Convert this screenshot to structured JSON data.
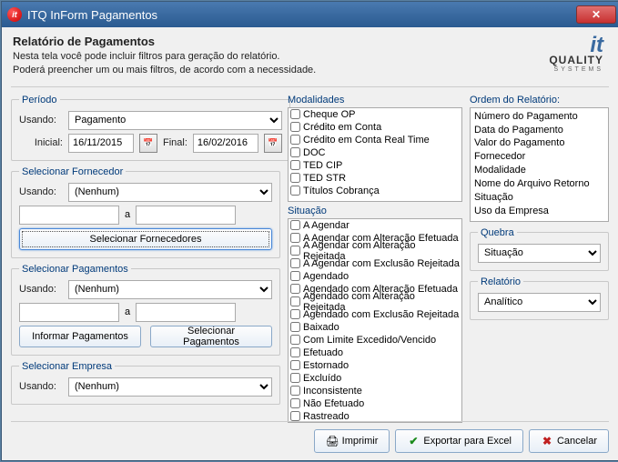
{
  "window": {
    "title": "ITQ InForm Pagamentos"
  },
  "header": {
    "title": "Relatório de Pagamentos",
    "desc_line1": "Nesta tela você pode incluir filtros para geração do relatório.",
    "desc_line2": "Poderá preencher um ou mais filtros, de acordo com a necessidade."
  },
  "periodo": {
    "legend": "Período",
    "usando_label": "Usando:",
    "usando_value": "Pagamento",
    "inicial_label": "Inicial:",
    "inicial_value": "16/11/2015",
    "final_label": "Final:",
    "final_value": "16/02/2016"
  },
  "fornecedor": {
    "legend": "Selecionar Fornecedor",
    "usando_label": "Usando:",
    "usando_value": "(Nenhum)",
    "range_from": "",
    "range_to": "",
    "sep": "a",
    "button": "Selecionar Fornecedores"
  },
  "pagamentos": {
    "legend": "Selecionar Pagamentos",
    "usando_label": "Usando:",
    "usando_value": "(Nenhum)",
    "range_from": "",
    "range_to": "",
    "sep": "a",
    "btn_informar": "Informar Pagamentos",
    "btn_selecionar": "Selecionar Pagamentos"
  },
  "empresa": {
    "legend": "Selecionar Empresa",
    "usando_label": "Usando:",
    "usando_value": "(Nenhum)"
  },
  "modalidades": {
    "label": "Modalidades",
    "items": [
      "Cheque OP",
      "Crédito em Conta",
      "Crédito em Conta Real Time",
      "DOC",
      "TED CIP",
      "TED STR",
      "Títulos Cobrança"
    ]
  },
  "situacao": {
    "label": "Situação",
    "items": [
      "A Agendar",
      "A Agendar com Alteração Efetuada",
      "A Agendar com Alteração Rejeitada",
      "A Agendar com Exclusão Rejeitada",
      "Agendado",
      "Agendado com Alteração Efetuada",
      "Agendado com Alteração Rejeitada",
      "Agendado com Exclusão Rejeitada",
      "Baixado",
      "Com Limite Excedido/Vencido",
      "Efetuado",
      "Estornado",
      "Excluído",
      "Inconsistente",
      "Não Efetuado",
      "Rastreado"
    ]
  },
  "ordem": {
    "label": "Ordem do Relatório:",
    "items": [
      "Número do Pagamento",
      "Data do Pagamento",
      "Valor do Pagamento",
      "Fornecedor",
      "Modalidade",
      "Nome do Arquivo Retorno",
      "Situação",
      "Uso da Empresa"
    ]
  },
  "quebra": {
    "legend": "Quebra",
    "value": "Situação"
  },
  "relatorio": {
    "legend": "Relatório",
    "value": "Analítico"
  },
  "buttons": {
    "imprimir": "Imprimir",
    "exportar": "Exportar para Excel",
    "cancelar": "Cancelar"
  }
}
